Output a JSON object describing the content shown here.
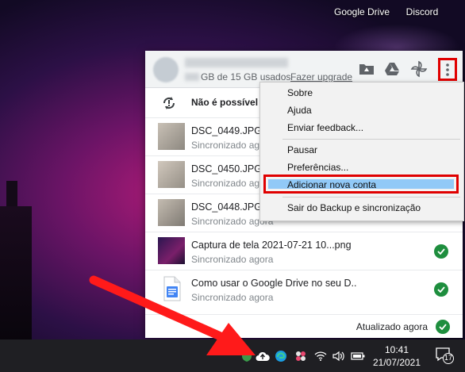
{
  "desktop": {
    "icons": [
      {
        "label": "Google Drive"
      },
      {
        "label": "Discord"
      }
    ]
  },
  "drive_panel": {
    "header": {
      "quota_text": "GB de 15 GB usados",
      "upgrade_link": "Fazer upgrade"
    },
    "error_row": {
      "text": "Não é possível s"
    },
    "files": [
      {
        "name": "DSC_0449.JPG",
        "status": "Sincronizado agora"
      },
      {
        "name": "DSC_0450.JPG",
        "status": "Sincronizado agora"
      },
      {
        "name": "DSC_0448.JPG",
        "status": "Sincronizado agora"
      },
      {
        "name": "Captura de tela 2021-07-21 10...png",
        "status": "Sincronizado agora"
      },
      {
        "name": "Como usar o Google Drive no seu D..",
        "status": "Sincronizado agora"
      }
    ],
    "footer": {
      "status": "Atualizado agora"
    }
  },
  "context_menu": {
    "items": [
      {
        "label": "Sobre"
      },
      {
        "label": "Ajuda"
      },
      {
        "label": "Enviar feedback..."
      },
      {
        "label": "Pausar"
      },
      {
        "label": "Preferências..."
      },
      {
        "label": "Adicionar nova conta"
      },
      {
        "label": "Sair do Backup e sincronização"
      }
    ]
  },
  "taskbar": {
    "time": "10:41",
    "date": "21/07/2021",
    "notification_count": "17"
  },
  "colors": {
    "highlight_border": "#e00000",
    "menu_highlight": "#91c9f7",
    "check_green": "#1e8e3e"
  }
}
